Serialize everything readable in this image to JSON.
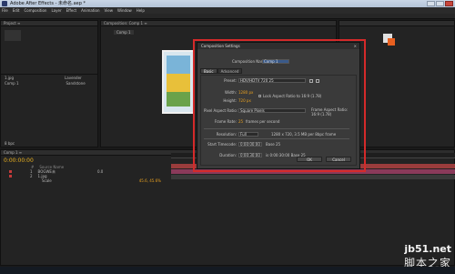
{
  "window": {
    "title": "Adobe After Effects - 未命名.aep *"
  },
  "menu": [
    "File",
    "Edit",
    "Composition",
    "Layer",
    "Effect",
    "Animation",
    "View",
    "Window",
    "Help"
  ],
  "project": {
    "header": "Project ≡",
    "items": [
      {
        "name": "1.jpg",
        "label": "Lavender"
      },
      {
        "name": "Comp 1",
        "label": "Sandstone"
      }
    ],
    "footer": "8 bpc"
  },
  "composition_panel": {
    "header": "Composition: Comp 1 ≡",
    "tab": "Comp 1"
  },
  "timeline": {
    "time": "0:00:00:00",
    "header": "Comp 1 ≡",
    "cols": [
      "#",
      "Source Name"
    ],
    "layers": [
      {
        "num": "1",
        "name": "BOGWE未",
        "extra": "0.0"
      },
      {
        "num": "2",
        "name": "1.jpg",
        "extra": ""
      }
    ],
    "scale_label": "Scale",
    "scale_value": "45.6, 45.6%"
  },
  "dialog": {
    "title": "Composition Settings",
    "comp_name_label": "Composition Name:",
    "comp_name_value": "Comp 1",
    "tabs": [
      "Basic",
      "Advanced"
    ],
    "preset_label": "Preset:",
    "preset_value": "HDV/HDTV 720 25",
    "width_label": "Width:",
    "width_value": "1280 px",
    "height_label": "Height:",
    "height_value": "720 px",
    "lock_label": "Lock Aspect Ratio to 16:9 (1.78)",
    "par_label": "Pixel Aspect Ratio:",
    "par_value": "Square Pixels",
    "frame_ar_label": "Frame Aspect Ratio:",
    "frame_ar_value": "16:9 (1.78)",
    "fps_label": "Frame Rate:",
    "fps_value": "25",
    "fps_unit": "frames per second",
    "res_label": "Resolution:",
    "res_value": "Full",
    "res_info": "1280 x 720, 3.5 MB per 8bpc frame",
    "start_label": "Start Timecode:",
    "start_value": "0:00:00:00",
    "start_info": "Base 25",
    "dur_label": "Duration:",
    "dur_value": "0:00:30:00",
    "dur_info": "is 0:00:30:00  Base 25",
    "ok": "OK",
    "cancel": "Cancel"
  },
  "watermark": {
    "line1": "jb51.net",
    "line2": "脚本之家"
  }
}
